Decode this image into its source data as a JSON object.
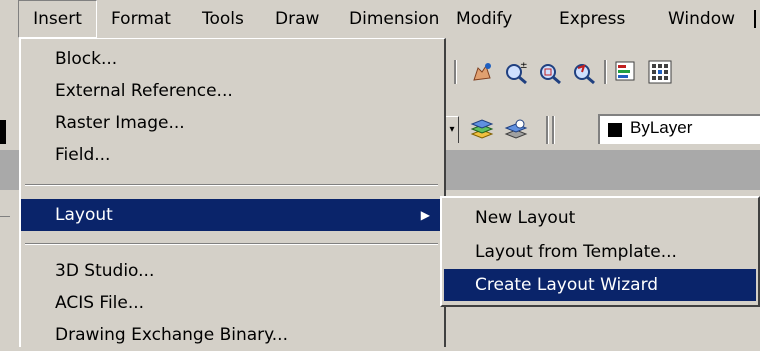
{
  "menubar": {
    "items": [
      "Insert",
      "Format",
      "Tools",
      "Draw",
      "Dimension",
      "Modify",
      "Express",
      "Window"
    ]
  },
  "toolbar": {
    "layer_value": "ByLayer",
    "icons": [
      "pan-realtime-icon",
      "zoom-realtime-icon",
      "zoom-window-icon",
      "zoom-previous-icon",
      "properties-icon",
      "design-center-icon",
      "layer-previous-icon",
      "make-object-layer-current-icon"
    ]
  },
  "insert_menu": {
    "items": [
      {
        "label": "Block..."
      },
      {
        "label": "External Reference..."
      },
      {
        "label": "Raster Image..."
      },
      {
        "label": "Field..."
      },
      {
        "label": "Layout",
        "selected": true,
        "has_submenu": true
      },
      {
        "label": "3D Studio..."
      },
      {
        "label": "ACIS File..."
      },
      {
        "label": "Drawing Exchange Binary..."
      }
    ],
    "submenu_arrow": "▶"
  },
  "layout_submenu": {
    "items": [
      {
        "label": "New Layout"
      },
      {
        "label": "Layout from Template..."
      },
      {
        "label": "Create Layout Wizard",
        "selected": true
      }
    ]
  },
  "colors": {
    "face": "#d4d0c8",
    "highlight": "#0a246a",
    "band": "#a9a9a9"
  }
}
